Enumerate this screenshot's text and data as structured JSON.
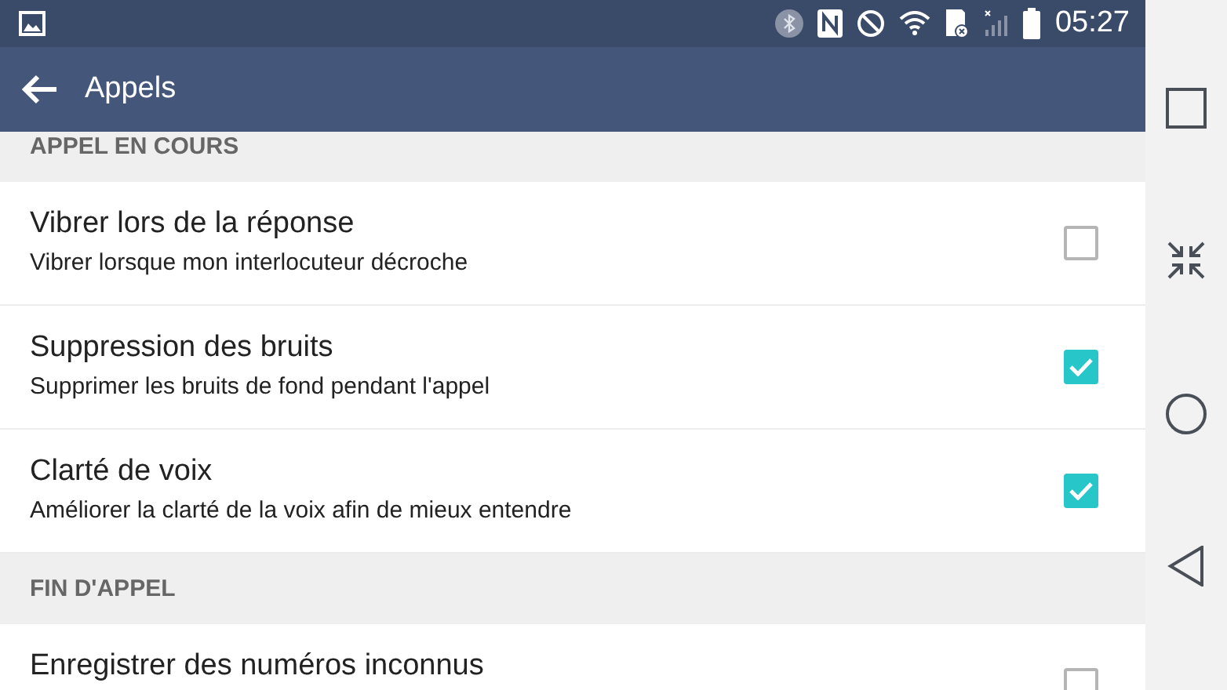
{
  "status_bar": {
    "time": "05:27"
  },
  "app_bar": {
    "title": "Appels"
  },
  "items": [
    {
      "kind": "header",
      "title": "APPEL EN COURS"
    },
    {
      "kind": "setting",
      "title": "Vibrer lors de la réponse",
      "subtitle": "Vibrer lorsque mon interlocuteur décroche",
      "checked": false
    },
    {
      "kind": "setting",
      "title": "Suppression des bruits",
      "subtitle": "Supprimer les bruits de fond pendant l'appel",
      "checked": true
    },
    {
      "kind": "setting",
      "title": "Clarté de voix",
      "subtitle": "Améliorer la clarté de la voix afin de mieux entendre",
      "checked": true
    },
    {
      "kind": "header",
      "title": "FIN D'APPEL"
    },
    {
      "kind": "setting",
      "title": "Enregistrer des numéros inconnus",
      "checked": false
    }
  ]
}
